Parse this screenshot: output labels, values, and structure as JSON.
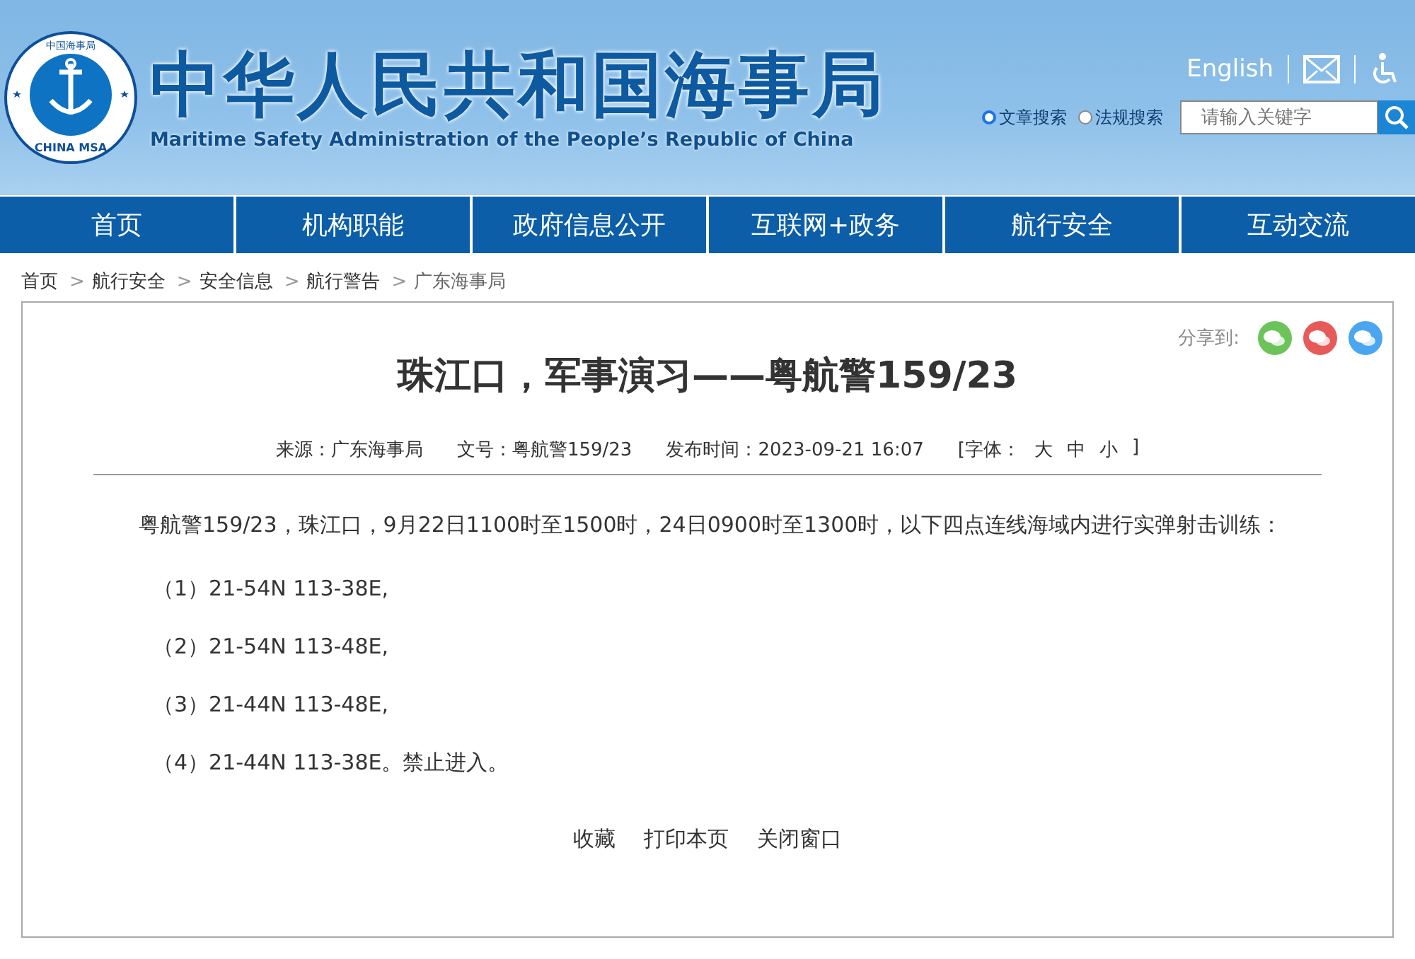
{
  "header": {
    "logo_top": "中国海事局",
    "logo_bottom": "CHINA MSA",
    "title": "中华人民共和国海事局",
    "subtitle": "Maritime Safety Administration of the People’s Republic of China",
    "english_link": "English",
    "search_options": [
      {
        "label": "文章搜索",
        "selected": true
      },
      {
        "label": "法规搜索",
        "selected": false
      }
    ],
    "search": {
      "placeholder": "请输入关键字"
    }
  },
  "nav": [
    "首页",
    "机构职能",
    "政府信息公开",
    "互联网+政务",
    "航行安全",
    "互动交流"
  ],
  "breadcrumb": [
    "首页",
    "航行安全",
    "安全信息",
    "航行警告",
    "广东海事局"
  ],
  "breadcrumb_separator": ">",
  "article": {
    "share_label": "分享到:",
    "title": "珠江口，军事演习——粤航警159/23",
    "meta": [
      {
        "kind": "text",
        "text": "来源：广东海事局"
      },
      {
        "kind": "text",
        "text": "文号：粤航警159/23"
      },
      {
        "kind": "text",
        "text": "发布时间：2023-09-21 16:07"
      },
      {
        "kind": "font",
        "text": "[字体：",
        "sizes": [
          "大",
          "中",
          "小"
        ],
        "end": "]"
      }
    ],
    "paragraphs": [
      "粤航警159/23，珠江口，9月22日1100时至1500时，24日0900时至1300时，以下四点连线海域内进行实弹射击训练："
    ],
    "points": [
      "（1）21-54N 113-38E,",
      "（2）21-54N 113-48E,",
      "（3）21-44N 113-48E,",
      "（4）21-44N 113-38E。禁止进入。"
    ],
    "footer_links": [
      "收藏",
      "打印本页",
      "关闭窗口"
    ]
  }
}
